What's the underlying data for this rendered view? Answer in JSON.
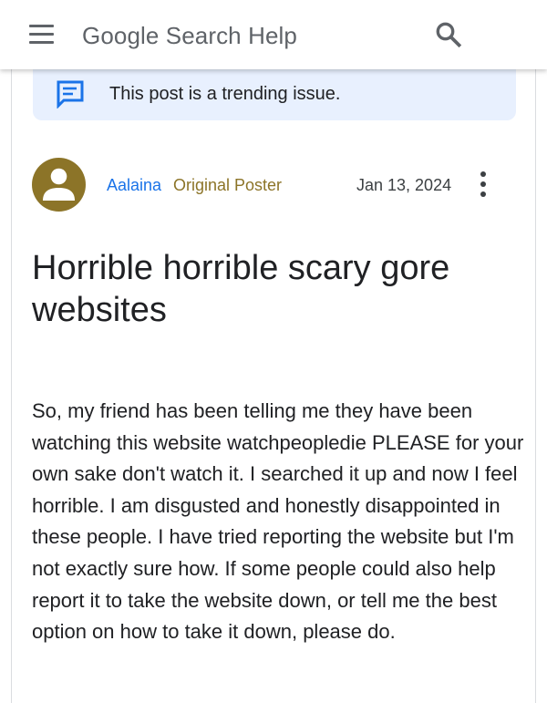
{
  "appbar": {
    "title": "Google Search Help",
    "menu_icon": "hamburger-menu-icon",
    "search_icon": "search-icon"
  },
  "banner": {
    "text": "This post is a trending issue.",
    "icon": "trending-feedback-icon",
    "background": "#e8f0fe",
    "icon_color": "#1a73e8"
  },
  "post": {
    "author": "Aalaina",
    "author_badge": "Original Poster",
    "date": "Jan 13, 2024",
    "title": "Horrible horrible scary gore websites",
    "body": "So, my friend has been telling me they have been watching this website watchpeopledie PLEASE for your own sake don't watch it. I searched it up and now I feel horrible. I am disgusted and honestly disappointed in these people. I have tried reporting the website but I'm not exactly sure how. If some people could also help report it to take the website down, or tell me the best option on how to take it down, please do.",
    "avatar_icon": "person-avatar-icon",
    "avatar_color": "#8c7428",
    "author_color": "#1a73e8",
    "badge_color": "#8c7428",
    "more_icon": "more-vert-icon"
  }
}
